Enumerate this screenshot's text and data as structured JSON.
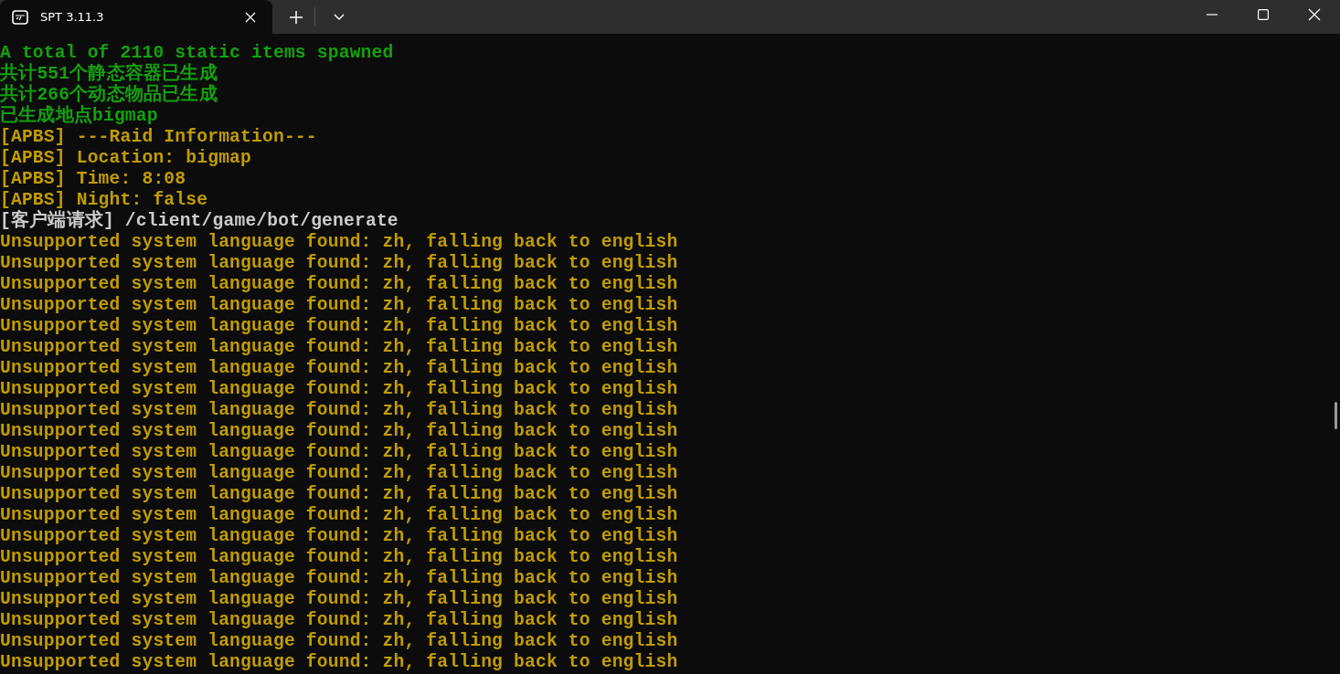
{
  "tab": {
    "title": "SPT 3.11.3"
  },
  "lines": [
    {
      "kind": "success",
      "text": "A total of 2110 static items spawned"
    },
    {
      "kind": "success",
      "text": "共计551个静态容器已生成"
    },
    {
      "kind": "success",
      "text": "共计266个动态物品已生成"
    },
    {
      "kind": "success",
      "text": "已生成地点bigmap"
    },
    {
      "kind": "warning",
      "text": "[APBS] ---Raid Information---"
    },
    {
      "kind": "warning",
      "text": "[APBS] Location: bigmap"
    },
    {
      "kind": "warning",
      "text": "[APBS] Time: 8:08"
    },
    {
      "kind": "warning",
      "text": "[APBS] Night: false"
    },
    {
      "kind": "plain",
      "text": "[客户端请求] /client/game/bot/generate"
    },
    {
      "kind": "warning",
      "text": "Unsupported system language found: zh, falling back to english"
    },
    {
      "kind": "warning",
      "text": "Unsupported system language found: zh, falling back to english"
    },
    {
      "kind": "warning",
      "text": "Unsupported system language found: zh, falling back to english"
    },
    {
      "kind": "warning",
      "text": "Unsupported system language found: zh, falling back to english"
    },
    {
      "kind": "warning",
      "text": "Unsupported system language found: zh, falling back to english"
    },
    {
      "kind": "warning",
      "text": "Unsupported system language found: zh, falling back to english"
    },
    {
      "kind": "warning",
      "text": "Unsupported system language found: zh, falling back to english"
    },
    {
      "kind": "warning",
      "text": "Unsupported system language found: zh, falling back to english"
    },
    {
      "kind": "warning",
      "text": "Unsupported system language found: zh, falling back to english"
    },
    {
      "kind": "warning",
      "text": "Unsupported system language found: zh, falling back to english"
    },
    {
      "kind": "warning",
      "text": "Unsupported system language found: zh, falling back to english"
    },
    {
      "kind": "warning",
      "text": "Unsupported system language found: zh, falling back to english"
    },
    {
      "kind": "warning",
      "text": "Unsupported system language found: zh, falling back to english"
    },
    {
      "kind": "warning",
      "text": "Unsupported system language found: zh, falling back to english"
    },
    {
      "kind": "warning",
      "text": "Unsupported system language found: zh, falling back to english"
    },
    {
      "kind": "warning",
      "text": "Unsupported system language found: zh, falling back to english"
    },
    {
      "kind": "warning",
      "text": "Unsupported system language found: zh, falling back to english"
    },
    {
      "kind": "warning",
      "text": "Unsupported system language found: zh, falling back to english"
    },
    {
      "kind": "warning",
      "text": "Unsupported system language found: zh, falling back to english"
    },
    {
      "kind": "warning",
      "text": "Unsupported system language found: zh, falling back to english"
    },
    {
      "kind": "warning",
      "text": "Unsupported system language found: zh, falling back to english"
    }
  ]
}
